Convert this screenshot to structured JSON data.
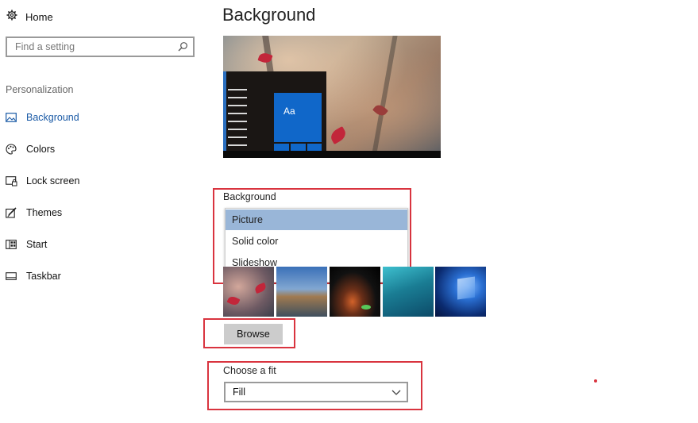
{
  "sidebar": {
    "home_label": "Home",
    "search_placeholder": "Find a setting",
    "section_label": "Personalization",
    "items": [
      {
        "label": "Background",
        "icon": "picture-icon",
        "active": true
      },
      {
        "label": "Colors",
        "icon": "palette-icon",
        "active": false
      },
      {
        "label": "Lock screen",
        "icon": "lock-screen-icon",
        "active": false
      },
      {
        "label": "Themes",
        "icon": "brush-icon",
        "active": false
      },
      {
        "label": "Start",
        "icon": "start-grid-icon",
        "active": false
      },
      {
        "label": "Taskbar",
        "icon": "taskbar-icon",
        "active": false
      }
    ]
  },
  "main": {
    "title": "Background",
    "preview": {
      "tile_label": "Aa"
    },
    "background_select": {
      "label": "Background",
      "options": [
        "Picture",
        "Solid color",
        "Slideshow"
      ],
      "selected": "Picture"
    },
    "browse_label": "Browse",
    "fit": {
      "label": "Choose a fit",
      "value": "Fill"
    }
  },
  "colors": {
    "accent": "#1a5aa6",
    "highlight_box": "#d9343f",
    "selected_option": "#99b6d8"
  }
}
